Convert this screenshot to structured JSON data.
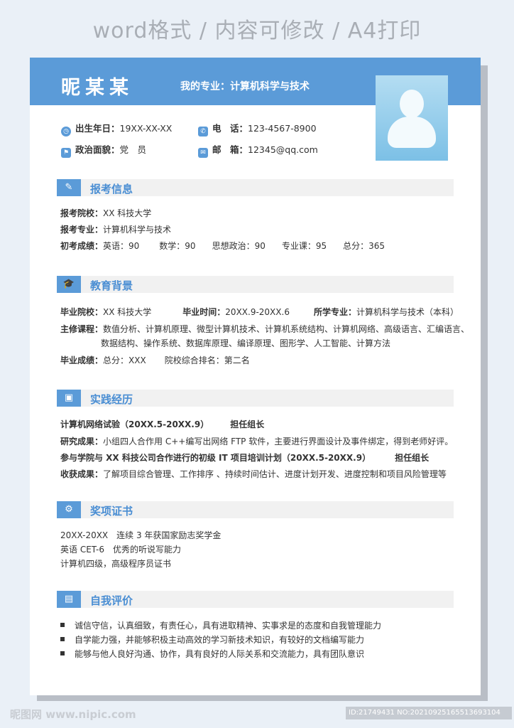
{
  "caption": "word格式 / 内容可修改 / A4打印",
  "header": {
    "name": "昵某某",
    "major_label": "我的专业：",
    "major_value": "计算机科学与技术"
  },
  "info": {
    "birth_label": "出生年日：",
    "birth_value": "19XX-XX-XX",
    "phone_label": "电　话：",
    "phone_value": "123-4567-8900",
    "politics_label": "政治面貌：",
    "politics_value": "党　员",
    "email_label": "邮　箱：",
    "email_value": "12345@qq.com"
  },
  "sections": {
    "apply": {
      "title": "报考信息",
      "school_label": "报考院校：",
      "school_value": "XX 科技大学",
      "major_label": "报考专业：",
      "major_value": "计算机科学与技术",
      "score_label": "初考成绩：",
      "scores": [
        "英语：90",
        "数学：90",
        "思想政治：90",
        "专业课：95",
        "总分：365"
      ]
    },
    "edu": {
      "title": "教育背景",
      "school_label": "毕业院校：",
      "school_value": "XX 科技大学",
      "time_label": "毕业时间：",
      "time_value": "20XX.9-20XX.6",
      "major_label": "所学专业：",
      "major_value": "计算机科学与技术（本科）",
      "courses_label": "主修课程：",
      "courses_line1": "数值分析、计算机原理、微型计算机技术、计算机系统结构、计算机网络、高级语言、汇编语言、",
      "courses_line2": "数据结构、操作系统、数据库原理、编译原理、图形学、人工智能、计算方法",
      "grade_label": "毕业成绩：",
      "grade_value": "总分：XXX",
      "rank_value": "院校综合排名：第二名"
    },
    "practice": {
      "title": "实践经历",
      "exp1_title": "计算机网络试验（20XX.5-20XX.9）",
      "exp1_role": "担任组长",
      "exp1_result_label": "研究成果：",
      "exp1_result_value": "小组四人合作用 C++编写出网络 FTP 软件，主要进行界面设计及事件绑定，得到老师好评。",
      "exp2_title": "参与学院与 XX 科技公司合作进行的初级 IT 项目培训计划（20XX.5-20XX.9）",
      "exp2_role": "担任组长",
      "exp2_result_label": "收获成果：",
      "exp2_result_value": "了解项目综合管理、工作排序 、持续时间估计、进度计划开发、进度控制和项目风险管理等"
    },
    "awards": {
      "title": "奖项证书",
      "items": [
        "20XX-20XX　连续 3 年获国家励志奖学金",
        "英语 CET-6　优秀的听说写能力",
        "计算机四级，高级程序员证书"
      ]
    },
    "self": {
      "title": "自我评价",
      "items": [
        "诚信守信，认真细致，有责任心，具有进取精神、实事求是的态度和自我管理能力",
        "自学能力强，并能够积极主动高效的学习新技术知识，有较好的文档编写能力",
        "能够与他人良好沟通、协作，具有良好的人际关系和交流能力，具有团队意识"
      ]
    }
  },
  "footer": {
    "watermark": "昵图网 www.nipic.com",
    "id_text": "ID:21749431 NO:20210925165513693104"
  },
  "colors": {
    "accent": "#5b9bd8",
    "section_title": "#4a8ed3",
    "section_bar": "#f1f1f1"
  }
}
